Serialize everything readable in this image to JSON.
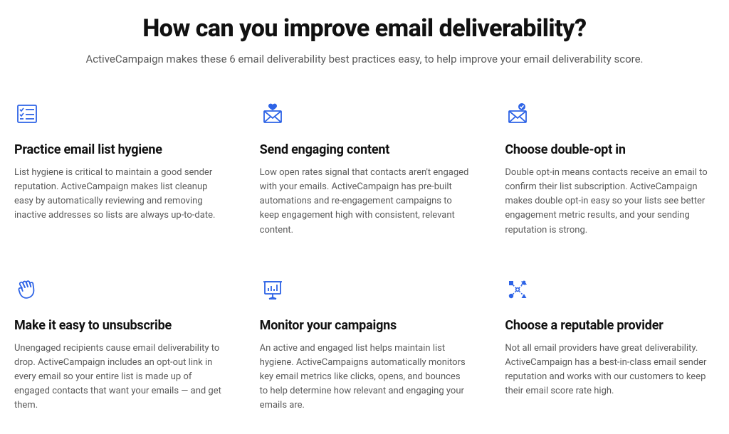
{
  "header": {
    "title": "How can you improve email deliverability?",
    "subtitle": "ActiveCampaign makes these 6 email deliverability best practices easy, to help improve your email deliverability score."
  },
  "cards": [
    {
      "icon": "checklist-icon",
      "title": "Practice email list hygiene",
      "body": "List hygiene is critical to maintain a good sender reputation. ActiveCampaign makes list cleanup easy by automatically reviewing and removing inactive addresses so lists are always up-to-date."
    },
    {
      "icon": "heart-envelope-icon",
      "title": "Send engaging content",
      "body": "Low open rates signal that contacts aren't engaged with your emails. ActiveCampaign has pre-built automations and re-engagement campaigns to keep engagement high with consistent, relevant content."
    },
    {
      "icon": "check-envelope-icon",
      "title": "Choose double-opt in",
      "body": "Double opt-in means contacts receive an email to confirm their list subscription. ActiveCampaign makes double opt-in easy so your lists see better engagement metric results, and your sending reputation is strong."
    },
    {
      "icon": "wave-hand-icon",
      "title": "Make it easy to unsubscribe",
      "body": "Unengaged recipients cause email deliverability to drop. ActiveCampaign includes an opt-out link in every email so your entire list is made up of engaged contacts that want your emails — and get them."
    },
    {
      "icon": "presentation-chart-icon",
      "title": "Monitor your campaigns",
      "body": "An active and engaged list helps maintain list hygiene. ActiveCampaigns automatically monitors key email metrics like clicks, opens, and bounces to help determine how relevant and engaging your emails are."
    },
    {
      "icon": "nodes-shapes-icon",
      "title": "Choose a reputable provider",
      "body": "Not all email providers have great deliverability. ActiveCampaign has a best-in-class email sender reputation and works with our customers to keep their email score rate high."
    }
  ],
  "colors": {
    "accent": "#2d63e6"
  }
}
